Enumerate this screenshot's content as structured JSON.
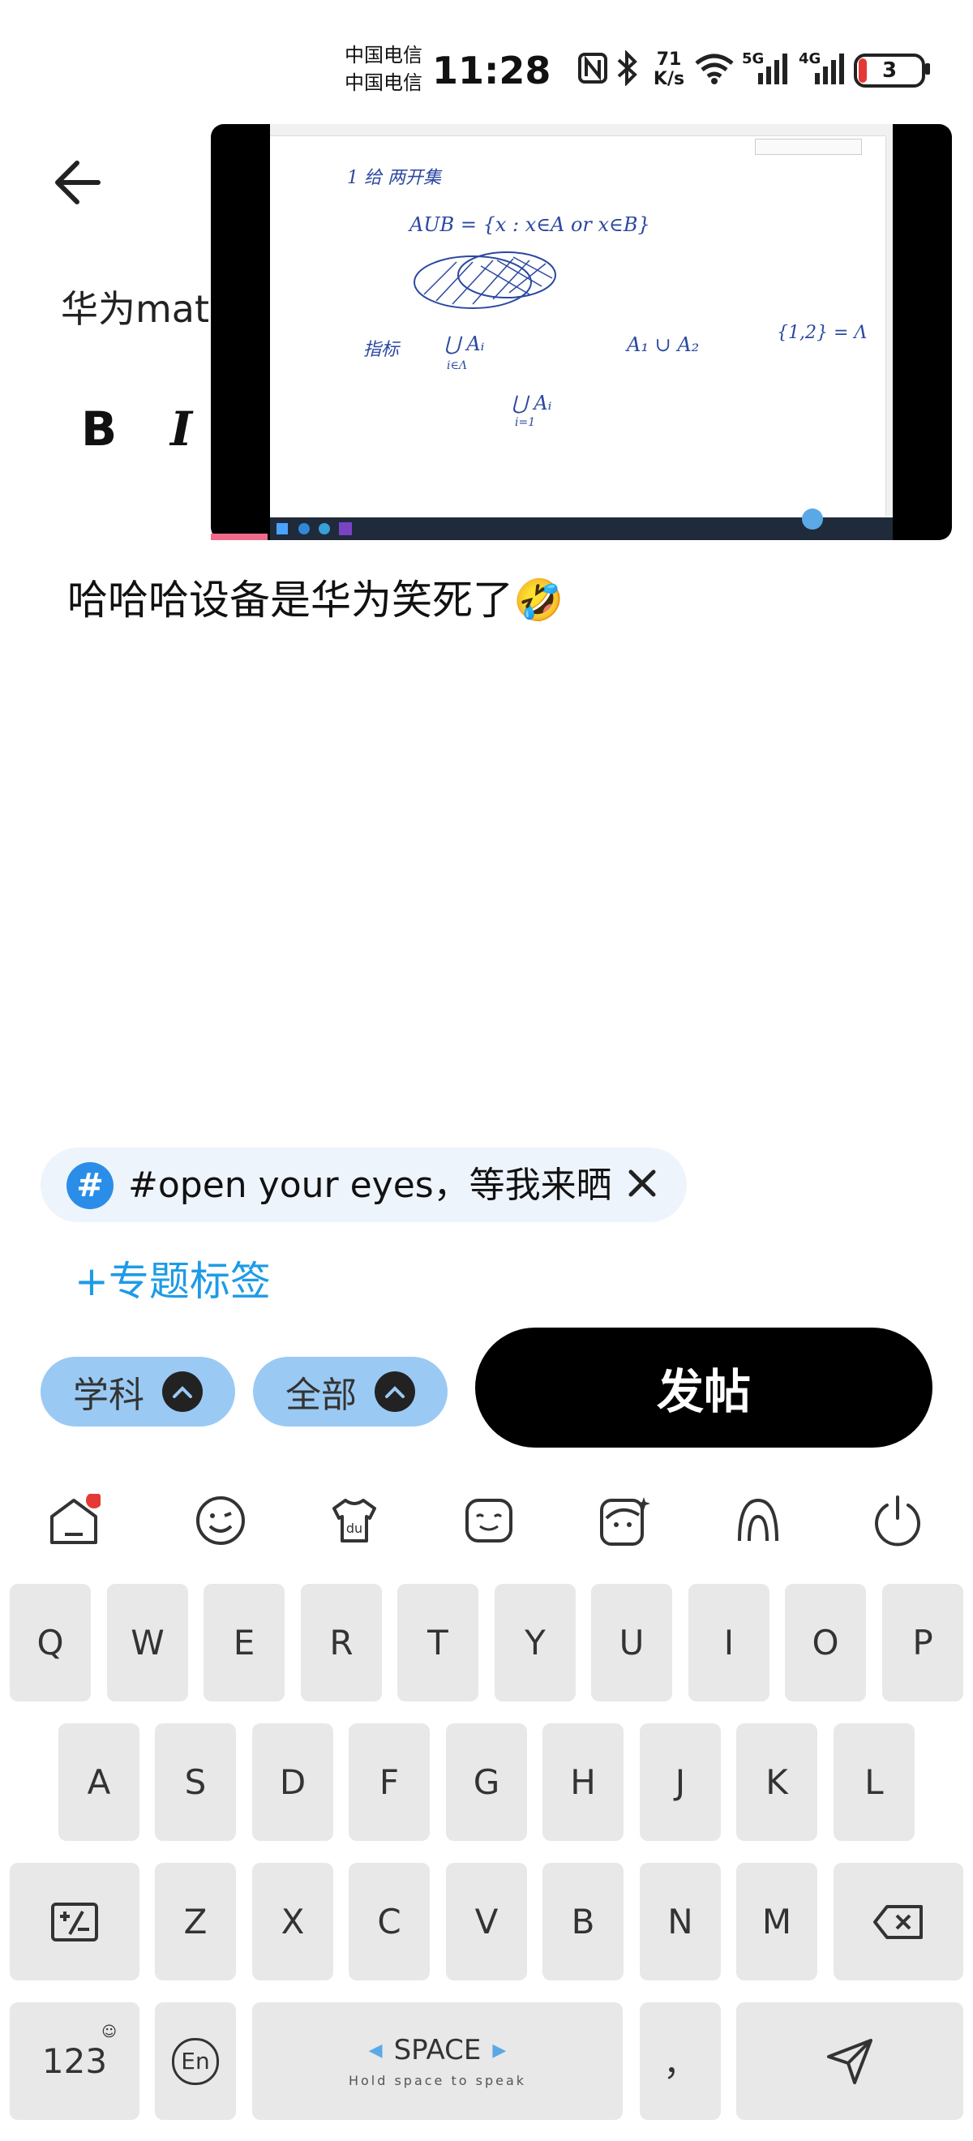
{
  "status": {
    "carrier1": "中国电信",
    "carrier2": "中国电信",
    "time": "11:28",
    "speed": "71\nK/s",
    "speed_top": "71",
    "speed_bottom": "K/s",
    "net1": "5G",
    "net2": "4G",
    "battery": "3"
  },
  "editor": {
    "title": "华为mat",
    "bold_label": "B",
    "italic_label": "I",
    "body": "哈哈哈设备是华为笑死了🤣"
  },
  "video": {
    "note_lines": [
      "1 给 两开集",
      "AUB = {x : x∈A or x∈B}",
      "指标",
      "⋃ Aᵢ",
      "i∈Λ",
      "A₁ ∪ A₂",
      "{1,2} = Λ",
      "⋃ Aᵢ",
      "i=1"
    ]
  },
  "tag": {
    "hash": "#",
    "text": "#open your eyes，等我来晒",
    "close": "✕"
  },
  "topic_label": "+专题标签",
  "chips": {
    "subject": "学科",
    "all": "全部"
  },
  "post_label": "发帖",
  "keyboard": {
    "row1": [
      "Q",
      "W",
      "E",
      "R",
      "T",
      "Y",
      "U",
      "I",
      "O",
      "P"
    ],
    "row2": [
      "A",
      "S",
      "D",
      "F",
      "G",
      "H",
      "J",
      "K",
      "L"
    ],
    "row3": [
      "Z",
      "X",
      "C",
      "V",
      "B",
      "N",
      "M"
    ],
    "num_key": "123",
    "lang_key": "En",
    "space_label": "SPACE",
    "space_hint": "Hold space to speak",
    "punct_key": "，",
    "icons": [
      "home-icon",
      "emoji-icon",
      "skin-icon",
      "sticker-icon",
      "avatar-icon",
      "handwriting-icon",
      "power-icon"
    ],
    "home_badge_color": "#e53935"
  }
}
